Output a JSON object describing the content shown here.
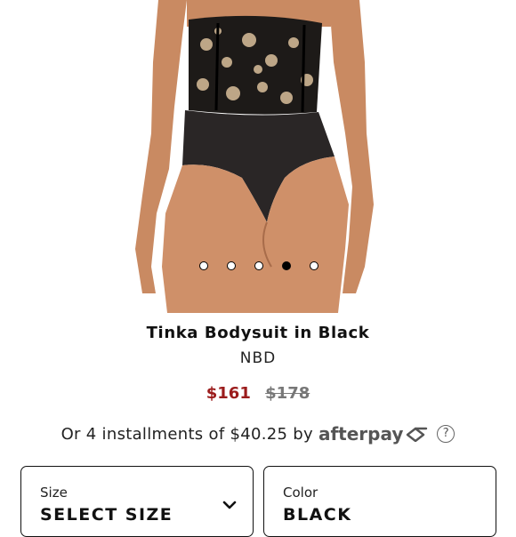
{
  "product": {
    "image_alt": "Tinka Bodysuit in Black product photo",
    "carousel": {
      "count": 5,
      "active_index": 3
    },
    "title": "Tinka Bodysuit in Black",
    "brand": "NBD",
    "price_sale": "$161",
    "price_original": "$178"
  },
  "installments": {
    "text": "Or 4 installments of $40.25 by",
    "provider": "afterpay",
    "help_label": "?"
  },
  "selectors": {
    "size": {
      "label": "Size",
      "value": "SELECT SIZE"
    },
    "color": {
      "label": "Color",
      "value": "BLACK"
    }
  },
  "colors": {
    "sale_price": "#9b1c1c",
    "original_price": "#777777",
    "afterpay": "#555555"
  },
  "icons": {
    "afterpay_logo": "afterpay-arrows-icon",
    "help": "question-circle-icon",
    "size_dropdown": "chevron-down-icon"
  }
}
